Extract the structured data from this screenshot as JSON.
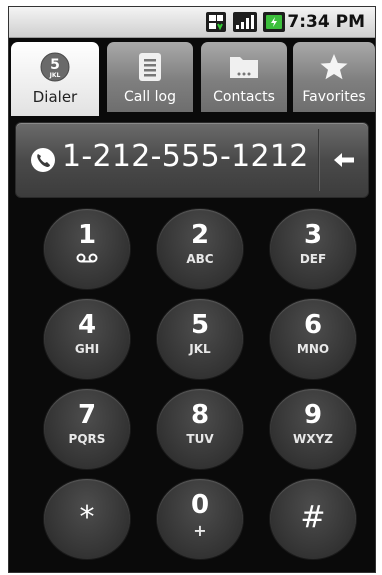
{
  "status_bar": {
    "time": "7:34 PM",
    "icons": [
      "sim-card-icon",
      "signal-strength-icon",
      "battery-charging-icon"
    ]
  },
  "tabs": [
    {
      "label": "Dialer",
      "icon": "dialer-icon",
      "icon_digit": "5",
      "icon_letters": "JKL",
      "selected": true
    },
    {
      "label": "Call log",
      "icon": "call-log-icon",
      "selected": false
    },
    {
      "label": "Contacts",
      "icon": "contacts-icon",
      "selected": false
    },
    {
      "label": "Favorites",
      "icon": "star-icon",
      "selected": false
    }
  ],
  "dialer": {
    "number": "1-212-555-1212",
    "phone_icon": "phone-icon",
    "backspace_icon": "backspace-arrow-icon"
  },
  "keypad": {
    "keys": [
      {
        "digit": "1",
        "letters": "",
        "extra_icon": "voicemail-icon"
      },
      {
        "digit": "2",
        "letters": "ABC"
      },
      {
        "digit": "3",
        "letters": "DEF"
      },
      {
        "digit": "4",
        "letters": "GHI"
      },
      {
        "digit": "5",
        "letters": "JKL"
      },
      {
        "digit": "6",
        "letters": "MNO"
      },
      {
        "digit": "7",
        "letters": "PQRS"
      },
      {
        "digit": "8",
        "letters": "TUV"
      },
      {
        "digit": "9",
        "letters": "WXYZ"
      },
      {
        "symbol": "*"
      },
      {
        "digit": "0",
        "letters": "+"
      },
      {
        "symbol": "#"
      }
    ]
  },
  "colors": {
    "background": "#0a0a0a",
    "tab_selected": "#eeeeee",
    "tab_unselected": "#8a8a8a",
    "key": "#363636",
    "text": "#ffffff"
  }
}
